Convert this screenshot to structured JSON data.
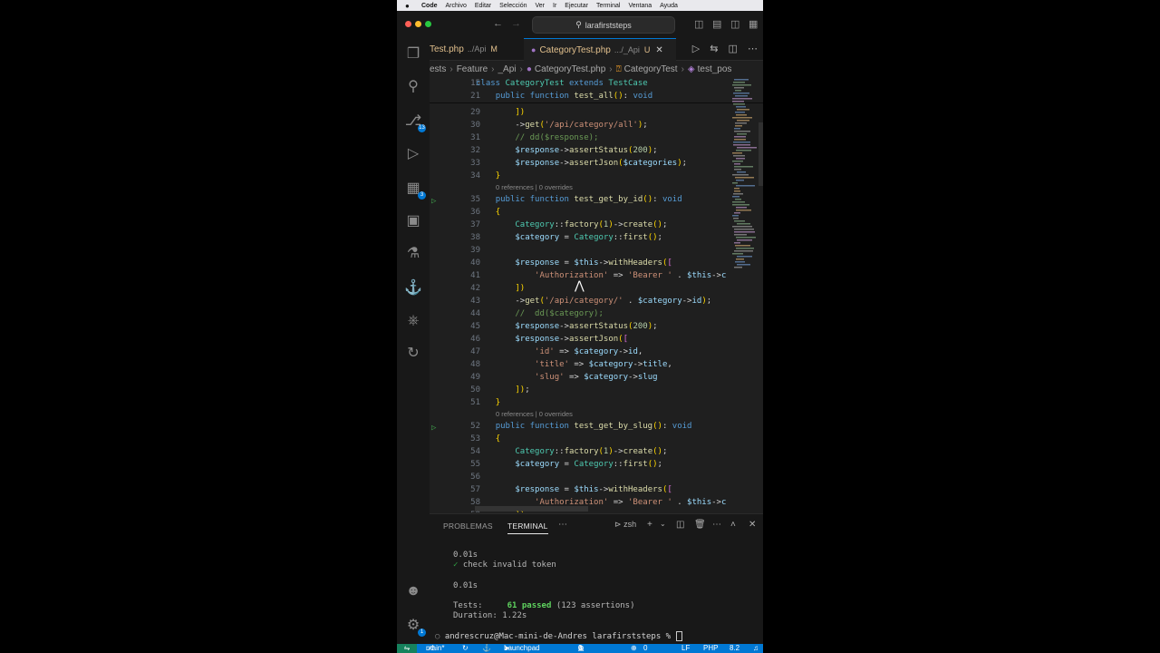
{
  "menubar": {
    "items": [
      "Code",
      "Archivo",
      "Editar",
      "Selección",
      "Ver",
      "Ir",
      "Ejecutar",
      "Terminal",
      "Ventana",
      "Ayuda"
    ]
  },
  "titlebar": {
    "search": "larafirststeps"
  },
  "activity": {
    "scm_badge": "13",
    "ext_badge": "3",
    "settings_badge": "1"
  },
  "tabs": [
    {
      "label": "Test.php",
      "desc": "../Api",
      "status": "M"
    },
    {
      "label": "CategoryTest.php",
      "desc": ".../_Api",
      "status": "U"
    }
  ],
  "breadcrumb": [
    "ests",
    "Feature",
    "_Api",
    "CategoryTest.php",
    "CategoryTest",
    "test_pos"
  ],
  "editor": {
    "lens_text": "0 references | 0 overrides",
    "lines": [
      {
        "n": "15",
        "t": "class CategoryTest extends TestCase"
      },
      {
        "n": "21",
        "t": "    public function test_all(): void"
      },
      {
        "n": "29",
        "t": "        ])"
      },
      {
        "n": "30",
        "t": "        ->get('/api/category/all');"
      },
      {
        "n": "31",
        "t": "        // dd($response);"
      },
      {
        "n": "32",
        "t": "        $response->assertStatus(200);"
      },
      {
        "n": "33",
        "t": "        $response->assertJson($categories);"
      },
      {
        "n": "34",
        "t": "    }"
      },
      {
        "n": "35",
        "t": "    public function test_get_by_id(): void"
      },
      {
        "n": "36",
        "t": "    {"
      },
      {
        "n": "37",
        "t": "        Category::factory(1)->create();"
      },
      {
        "n": "38",
        "t": "        $category = Category::first();"
      },
      {
        "n": "39",
        "t": ""
      },
      {
        "n": "40",
        "t": "        $response = $this->withHeaders(["
      },
      {
        "n": "41",
        "t": "            'Authorization' => 'Bearer ' . $this->c"
      },
      {
        "n": "42",
        "t": "        ])"
      },
      {
        "n": "43",
        "t": "        ->get('/api/category/' . $category->id);"
      },
      {
        "n": "44",
        "t": "        //  dd($category);"
      },
      {
        "n": "45",
        "t": "        $response->assertStatus(200);"
      },
      {
        "n": "46",
        "t": "        $response->assertJson(["
      },
      {
        "n": "47",
        "t": "            'id' => $category->id,"
      },
      {
        "n": "48",
        "t": "            'title' => $category->title,"
      },
      {
        "n": "49",
        "t": "            'slug' => $category->slug"
      },
      {
        "n": "50",
        "t": "        ]);"
      },
      {
        "n": "51",
        "t": "    }"
      },
      {
        "n": "52",
        "t": "    public function test_get_by_slug(): void"
      },
      {
        "n": "53",
        "t": "    {"
      },
      {
        "n": "54",
        "t": "        Category::factory(1)->create();"
      },
      {
        "n": "55",
        "t": "        $category = Category::first();"
      },
      {
        "n": "56",
        "t": ""
      },
      {
        "n": "57",
        "t": "        $response = $this->withHeaders(["
      },
      {
        "n": "58",
        "t": "            'Authorization' => 'Bearer ' . $this->c"
      },
      {
        "n": "59",
        "t": "        ])"
      }
    ]
  },
  "panel": {
    "tabs": [
      "PROBLEMAS",
      "TERMINAL"
    ],
    "shell": "zsh",
    "terminal": {
      "l1": "0.01s",
      "l2": "check invalid token",
      "l3": "0.01s",
      "tests_label": "Tests:",
      "tests_passed": "61 passed",
      "tests_assertions": "(123 assertions)",
      "duration_label": "Duration:",
      "duration": "1.22s",
      "prompt": "andrescruz@Mac-mini-de-Andres larafirststeps %"
    }
  },
  "statusbar": {
    "branch": "main*",
    "launchpad": "Launchpad",
    "errors": "0",
    "warnings": "0",
    "eol": "LF",
    "lang": "PHP",
    "version": "8.2"
  }
}
